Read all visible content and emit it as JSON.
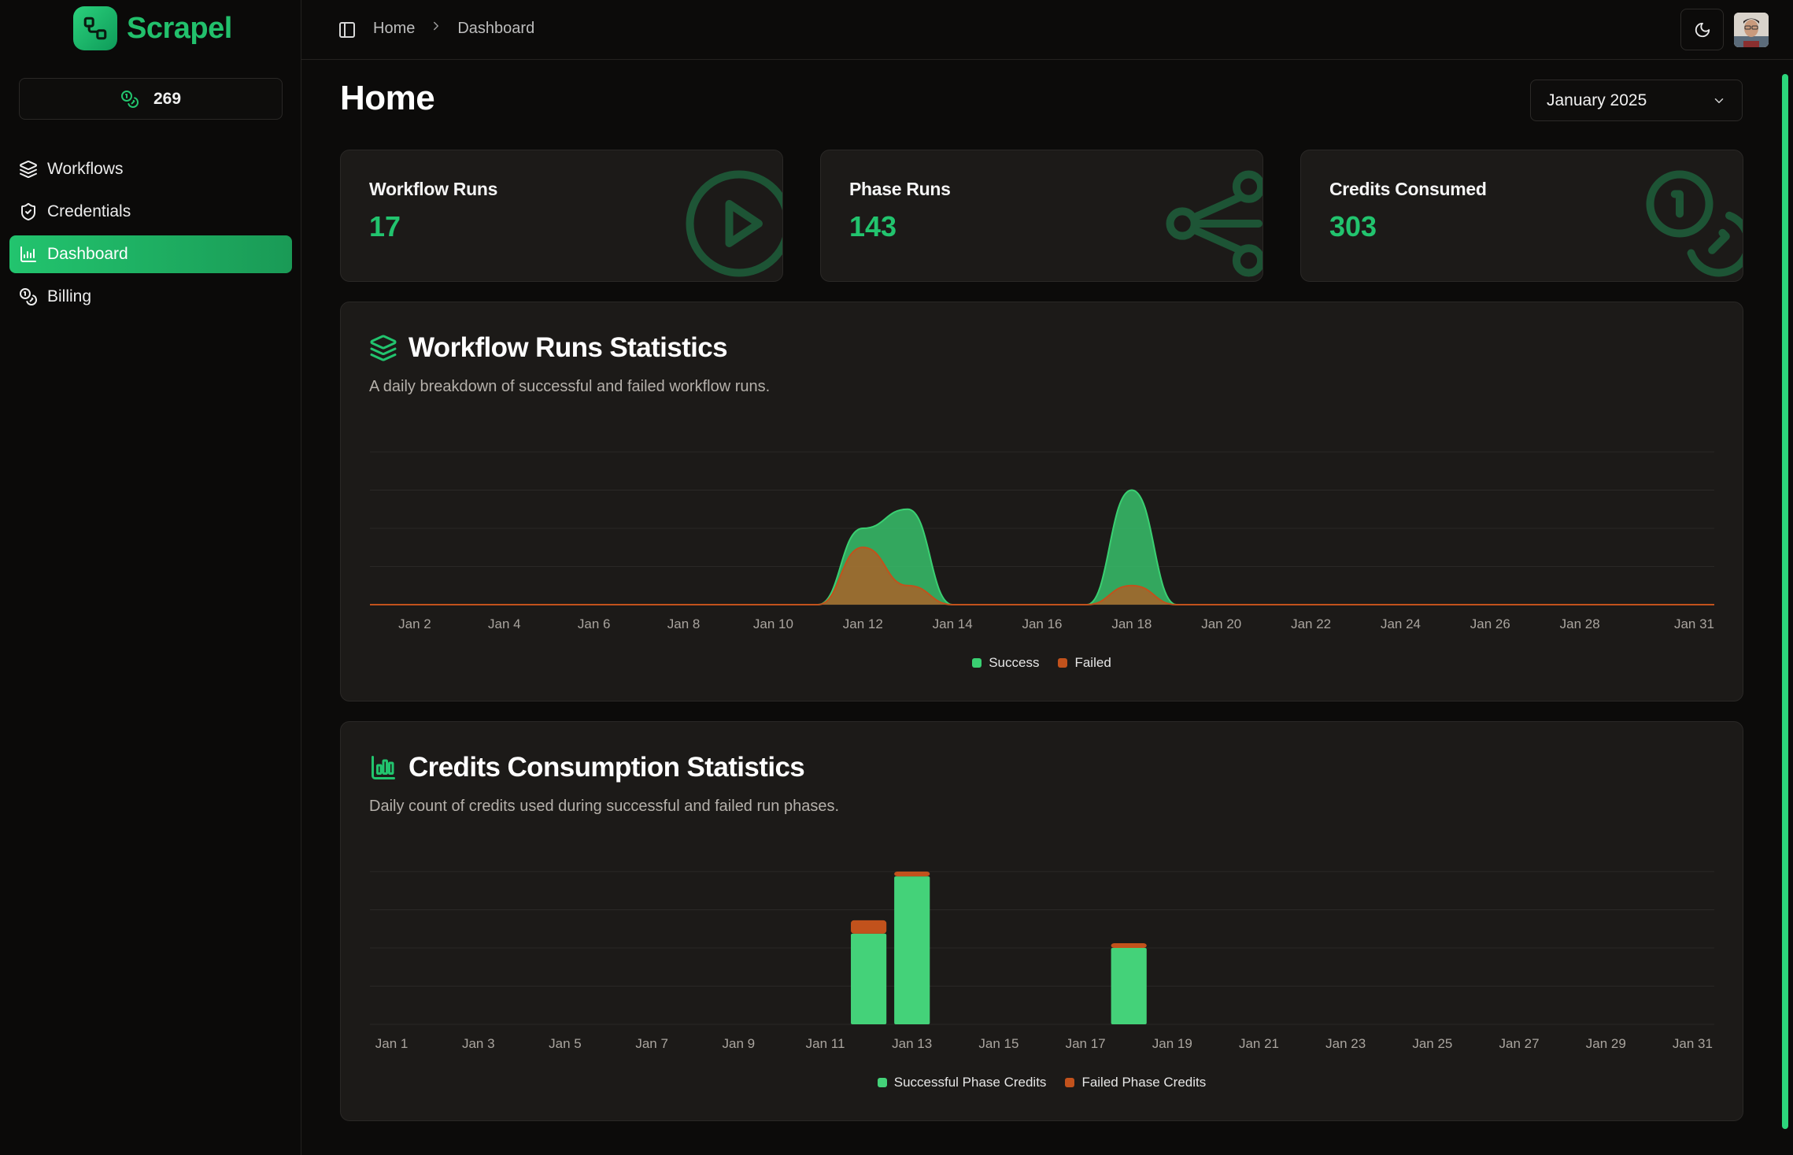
{
  "app": {
    "name": "Scrapel"
  },
  "sidebar": {
    "credits": "269",
    "items": [
      {
        "label": "Workflows",
        "icon": "layers-icon",
        "active": false
      },
      {
        "label": "Credentials",
        "icon": "shield-check-icon",
        "active": false
      },
      {
        "label": "Dashboard",
        "icon": "bar-chart-icon",
        "active": true
      },
      {
        "label": "Billing",
        "icon": "coins-icon",
        "active": false
      }
    ]
  },
  "header": {
    "breadcrumb": [
      "Home",
      "Dashboard"
    ],
    "theme_icon": "moon-icon"
  },
  "main": {
    "title": "Home",
    "period_select": "January 2025",
    "stats": [
      {
        "label": "Workflow Runs",
        "value": "17",
        "icon": "play-circle-icon"
      },
      {
        "label": "Phase Runs",
        "value": "143",
        "icon": "waypoints-icon"
      },
      {
        "label": "Credits Consumed",
        "value": "303",
        "icon": "coins-icon"
      }
    ]
  },
  "colors": {
    "accent": "#22c46e",
    "success": "#3ad072",
    "failed": "#c2521c",
    "panel": "#1c1a18",
    "background": "#0c0b0a"
  },
  "chart_data": [
    {
      "type": "area",
      "title": "Workflow Runs Statistics",
      "subtitle": "A daily breakdown of successful and failed workflow runs.",
      "x_ticks": [
        "Jan 2",
        "Jan 4",
        "Jan 6",
        "Jan 8",
        "Jan 10",
        "Jan 12",
        "Jan 14",
        "Jan 16",
        "Jan 18",
        "Jan 20",
        "Jan 22",
        "Jan 24",
        "Jan 26",
        "Jan 28",
        "Jan 31"
      ],
      "x": [
        1,
        2,
        3,
        4,
        5,
        6,
        7,
        8,
        9,
        10,
        11,
        12,
        13,
        14,
        15,
        16,
        17,
        18,
        19,
        20,
        21,
        22,
        23,
        24,
        25,
        26,
        27,
        28,
        29,
        30,
        31
      ],
      "ylim": [
        0,
        8
      ],
      "grid": true,
      "legend": "bottom-center",
      "series": [
        {
          "name": "Success",
          "color": "#3ad072",
          "values": [
            0,
            0,
            0,
            0,
            0,
            0,
            0,
            0,
            0,
            0,
            0,
            4,
            5,
            0,
            0,
            0,
            0,
            6,
            0,
            0,
            0,
            0,
            0,
            0,
            0,
            0,
            0,
            0,
            0,
            0,
            0
          ]
        },
        {
          "name": "Failed",
          "color": "#c2521c",
          "values": [
            0,
            0,
            0,
            0,
            0,
            0,
            0,
            0,
            0,
            0,
            0,
            3,
            1,
            0,
            0,
            0,
            0,
            1,
            0,
            0,
            0,
            0,
            0,
            0,
            0,
            0,
            0,
            0,
            0,
            0,
            0
          ]
        }
      ]
    },
    {
      "type": "bar",
      "title": "Credits Consumption Statistics",
      "subtitle": "Daily count of credits used during successful and failed run phases.",
      "x_ticks": [
        "Jan 1",
        "Jan 3",
        "Jan 5",
        "Jan 7",
        "Jan 9",
        "Jan 11",
        "Jan 13",
        "Jan 15",
        "Jan 17",
        "Jan 19",
        "Jan 21",
        "Jan 23",
        "Jan 25",
        "Jan 27",
        "Jan 29",
        "Jan 31"
      ],
      "x": [
        1,
        2,
        3,
        4,
        5,
        6,
        7,
        8,
        9,
        10,
        11,
        12,
        13,
        14,
        15,
        16,
        17,
        18,
        19,
        20,
        21,
        22,
        23,
        24,
        25,
        26,
        27,
        28,
        29,
        30,
        31
      ],
      "ylim": [
        0,
        160
      ],
      "stacked": true,
      "grid": true,
      "legend": "bottom-center",
      "series": [
        {
          "name": "Successful Phase Credits",
          "color": "#44d279",
          "values": [
            0,
            0,
            0,
            0,
            0,
            0,
            0,
            0,
            0,
            0,
            0,
            95,
            155,
            0,
            0,
            0,
            0,
            80,
            0,
            0,
            0,
            0,
            0,
            0,
            0,
            0,
            0,
            0,
            0,
            0,
            0
          ]
        },
        {
          "name": "Failed Phase Credits",
          "color": "#c2521c",
          "values": [
            0,
            0,
            0,
            0,
            0,
            0,
            0,
            0,
            0,
            0,
            0,
            14,
            5,
            0,
            0,
            0,
            0,
            5,
            0,
            0,
            0,
            0,
            0,
            0,
            0,
            0,
            0,
            0,
            0,
            0,
            0
          ]
        }
      ]
    }
  ]
}
